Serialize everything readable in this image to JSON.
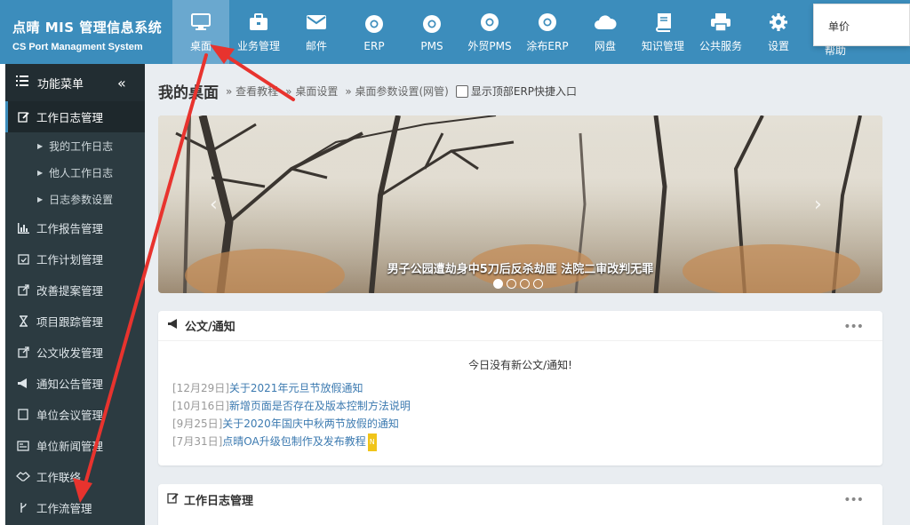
{
  "app": {
    "title_cn": "点晴 MIS 管理信息系统",
    "title_en": "CS Port Managment System"
  },
  "nav": [
    {
      "label": "桌面",
      "icon": "monitor-icon",
      "active": true
    },
    {
      "label": "业务管理",
      "icon": "briefcase-icon"
    },
    {
      "label": "邮件",
      "icon": "envelope-icon"
    },
    {
      "label": "ERP",
      "icon": "chrome-icon"
    },
    {
      "label": "PMS",
      "icon": "chrome-icon"
    },
    {
      "label": "外贸PMS",
      "icon": "chrome-icon"
    },
    {
      "label": "涂布ERP",
      "icon": "chrome-icon"
    },
    {
      "label": "网盘",
      "icon": "cloud-icon"
    },
    {
      "label": "知识管理",
      "icon": "book-icon"
    },
    {
      "label": "公共服务",
      "icon": "printer-icon"
    },
    {
      "label": "设置",
      "icon": "gear-icon"
    }
  ],
  "popup": {
    "text": "单价",
    "help_label": "帮助"
  },
  "sidebar": {
    "header": "功能菜单",
    "collapse_glyph": "«",
    "open_item": "工作日志管理",
    "sub_items": [
      "我的工作日志",
      "他人工作日志",
      "日志参数设置"
    ],
    "items": [
      {
        "label": "工作报告管理",
        "icon": "bar-chart-icon"
      },
      {
        "label": "工作计划管理",
        "icon": "calendar-check-icon"
      },
      {
        "label": "改善提案管理",
        "icon": "external-edit-icon"
      },
      {
        "label": "项目跟踪管理",
        "icon": "hourglass-icon"
      },
      {
        "label": "公文收发管理",
        "icon": "external-edit-icon"
      },
      {
        "label": "通知公告管理",
        "icon": "bullhorn-icon"
      },
      {
        "label": "单位会议管理",
        "icon": "note-icon"
      },
      {
        "label": "单位新闻管理",
        "icon": "newspaper-icon"
      },
      {
        "label": "工作联络",
        "icon": "handshake-icon"
      },
      {
        "label": "工作流管理",
        "icon": "branch-icon"
      }
    ]
  },
  "page": {
    "title": "我的桌面",
    "crumbs": [
      "» 查看教程",
      "» 桌面设置",
      "» 桌面参数设置(网管)"
    ],
    "checkbox_label": "显示顶部ERP快捷入口"
  },
  "banner": {
    "caption": "男子公园遭劫身中5刀后反杀劫匪 法院二审改判无罪",
    "slides": 4,
    "active_slide": 0
  },
  "notice_panel": {
    "title": "公文/通知",
    "empty_text": "今日没有新公文/通知!",
    "items": [
      {
        "date": "[12月29日]",
        "text": "关于2021年元旦节放假通知"
      },
      {
        "date": "[10月16日]",
        "text": "新增页面是否存在及版本控制方法说明"
      },
      {
        "date": "[9月25日]",
        "text": "关于2020年国庆中秋两节放假的通知"
      },
      {
        "date": "[7月31日]",
        "text": "点晴OA升级包制作及发布教程",
        "badge": "N"
      }
    ]
  },
  "worklog_panel": {
    "title": "工作日志管理"
  },
  "colors": {
    "topbar": "#3c8dbc",
    "sidebar": "#2c3b41",
    "annotation": "#e8332e"
  }
}
